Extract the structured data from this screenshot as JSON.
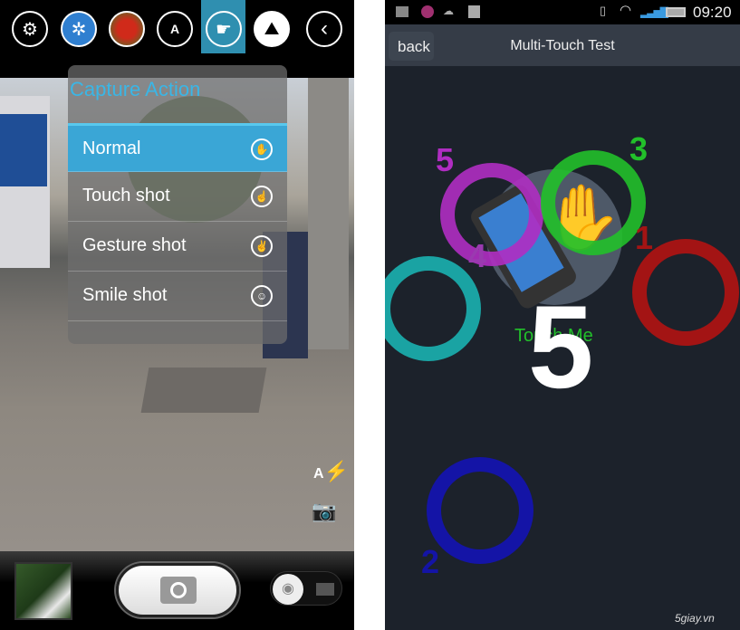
{
  "camera": {
    "toolbar": [
      {
        "icon": "gear-icon"
      },
      {
        "icon": "dandelion-scene-icon"
      },
      {
        "icon": "parrot-effect-icon"
      },
      {
        "icon": "auto-exposure-icon"
      },
      {
        "icon": "capture-action-icon",
        "active": true
      },
      {
        "icon": "gallery-icon"
      },
      {
        "icon": "back-icon"
      }
    ],
    "menu": {
      "title": "Capture Action",
      "items": [
        {
          "label": "Normal",
          "icon": "hand-press-icon",
          "selected": true
        },
        {
          "label": "Touch shot",
          "icon": "touch-icon"
        },
        {
          "label": "Gesture shot",
          "icon": "gesture-icon"
        },
        {
          "label": "Smile shot",
          "icon": "smile-icon"
        }
      ]
    },
    "flash_label": "A",
    "accent": "#2f8fb0"
  },
  "touch": {
    "status": {
      "time": "09:20"
    },
    "back_label": "back",
    "title": "Multi-Touch Test",
    "touch_me": "Touch Me",
    "count": "5",
    "labels": {
      "p5": "5",
      "p4": "4",
      "p3": "3",
      "p1": "1",
      "p2": "2"
    },
    "colors": {
      "purple": "#b02dc2",
      "green": "#22c02a",
      "red": "#a31414",
      "teal": "#1aa3a3",
      "blue": "#1414a6"
    }
  },
  "watermark": "5giay.vn"
}
